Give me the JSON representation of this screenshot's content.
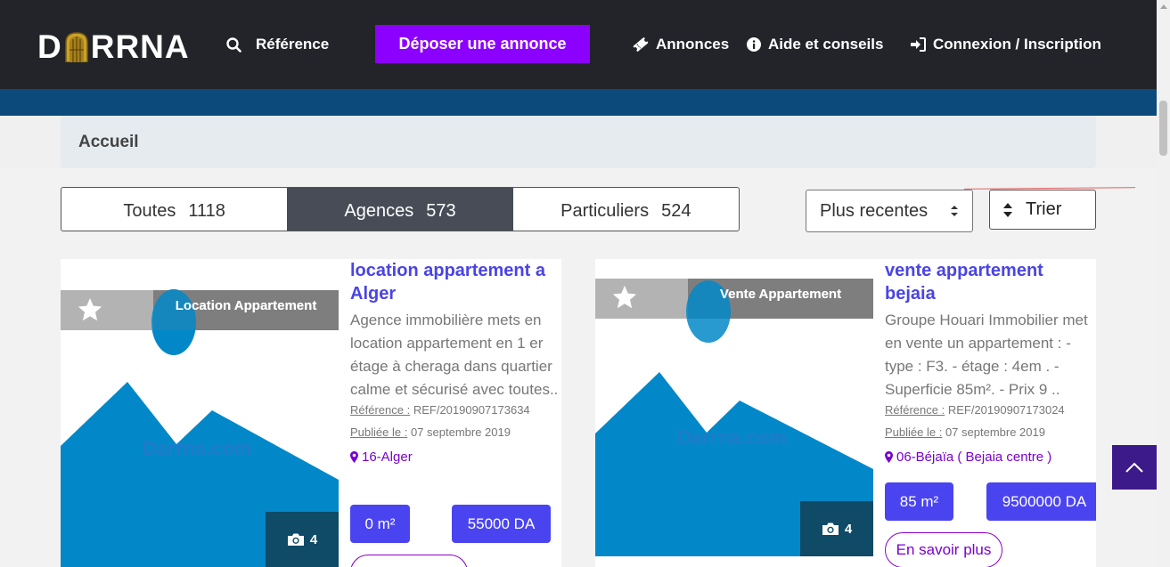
{
  "header": {
    "logo_text_left": "D",
    "logo_text_right": "RRNA",
    "reference_label": "Référence",
    "deposit_label": "Déposer une annonce",
    "annonces_label": "Annonces",
    "aide_label": "Aide et conseils",
    "connexion_label": "Connexion / Inscription"
  },
  "breadcrumb": {
    "home": "Accueil"
  },
  "filters": {
    "tabs": [
      {
        "label": "Toutes",
        "count": "1118"
      },
      {
        "label": "Agences",
        "count": "573"
      },
      {
        "label": "Particuliers",
        "count": "524"
      }
    ],
    "sort_selected": "Plus recentes",
    "sort_button": "Trier"
  },
  "listings": [
    {
      "category": "Location Appartement",
      "watermark": "Darrna.com",
      "photo_count": "4",
      "title": "location appartement a Alger",
      "description": "Agence immobilière mets en location appartement en 1 er étage à cheraga dans quartier calme et sécurisé avec toutes..",
      "reference_label": "Référence :",
      "reference": "REF/20190907173634",
      "published_label": "Publiée le :",
      "published": "07 septembre 2019",
      "location": "16-Alger",
      "area": "0 m²",
      "price": "55000 DA"
    },
    {
      "category": "Vente Appartement",
      "watermark": "Darrna.com",
      "photo_count": "4",
      "title": "vente appartement bejaia",
      "description": "Groupe Houari Immobilier met en vente un appartement : - type : F3. - étage : 4em . - Superficie 85m². - Prix 9 ..",
      "reference_label": "Référence :",
      "reference": "REF/20190907173024",
      "published_label": "Publiée le :",
      "published": "07 septembre 2019",
      "location": "06-Béjaïa ( Bejaia centre )",
      "area": "85 m²",
      "price": "9500000 DA",
      "more_label": "En savoir plus"
    }
  ],
  "colors": {
    "header_bg": "#222429",
    "accent_purple": "#8b00ff",
    "title_blue": "#4a44e6",
    "pill_blue": "#4a44f0",
    "image_blue": "#0288c8"
  }
}
